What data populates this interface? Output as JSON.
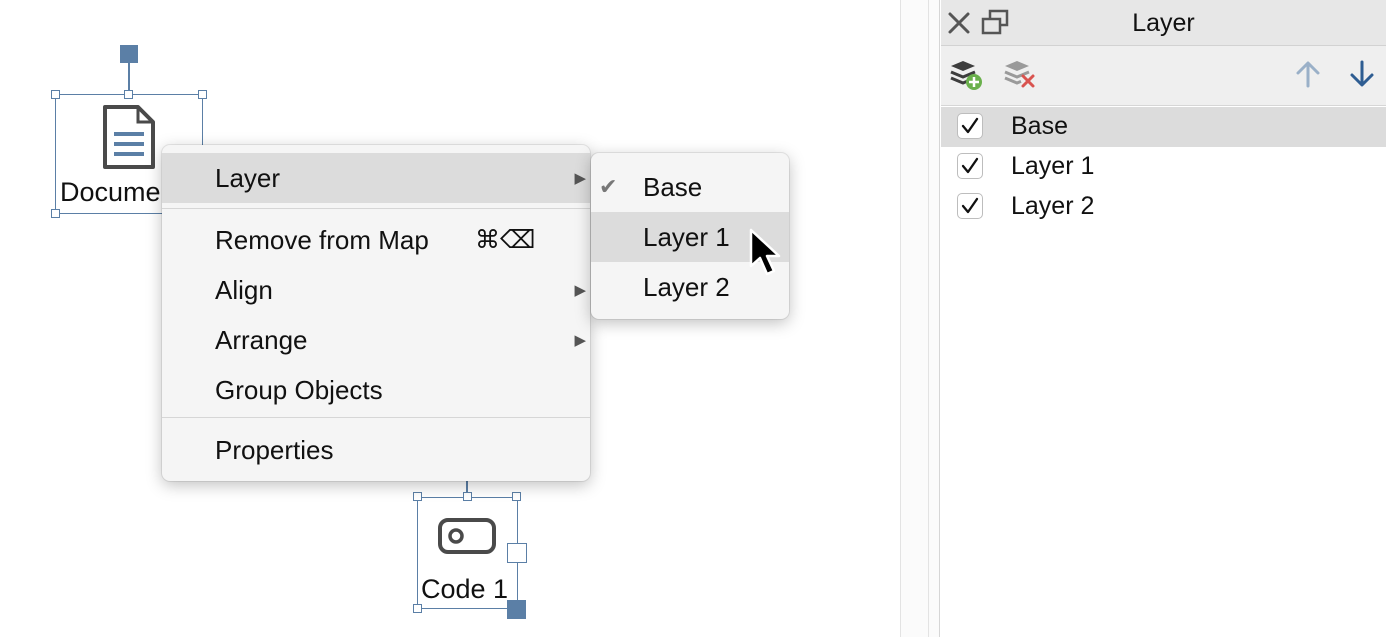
{
  "canvas": {
    "nodes": [
      {
        "id": "document",
        "label": "Document"
      },
      {
        "id": "code",
        "label": "Code 1"
      }
    ]
  },
  "context_menu": {
    "items": [
      {
        "label": "Layer",
        "has_submenu": true,
        "highlighted": true
      },
      {
        "label": "Remove from Map",
        "shortcut": "⌘⌫"
      },
      {
        "label": "Align",
        "has_submenu": true
      },
      {
        "label": "Arrange",
        "has_submenu": true
      },
      {
        "label": "Group Objects"
      },
      {
        "label": "Properties"
      }
    ],
    "submenu_arrow": "▶"
  },
  "layer_submenu": {
    "items": [
      {
        "label": "Base",
        "checked": true
      },
      {
        "label": "Layer 1",
        "highlighted": true
      },
      {
        "label": "Layer 2"
      }
    ],
    "check_glyph": "✔"
  },
  "layer_panel": {
    "title": "Layer",
    "header_icons": [
      "close-icon",
      "detach-window-icon"
    ],
    "toolbar_icons": [
      "add-layer-icon",
      "remove-layer-icon",
      "move-layer-up-icon",
      "move-layer-down-icon"
    ],
    "layers": [
      {
        "label": "Base",
        "visible": true,
        "selected": true
      },
      {
        "label": "Layer 1",
        "visible": true,
        "selected": false
      },
      {
        "label": "Layer 2",
        "visible": true,
        "selected": false
      }
    ]
  },
  "colors": {
    "selection": "#5b7fa6",
    "menu_bg": "#f5f5f5",
    "highlight": "#dcdcdc",
    "arrow_up": "#9ab0c8",
    "arrow_down": "#2e5d92",
    "add_green": "#6ab04c",
    "remove_red": "#d9534f"
  }
}
